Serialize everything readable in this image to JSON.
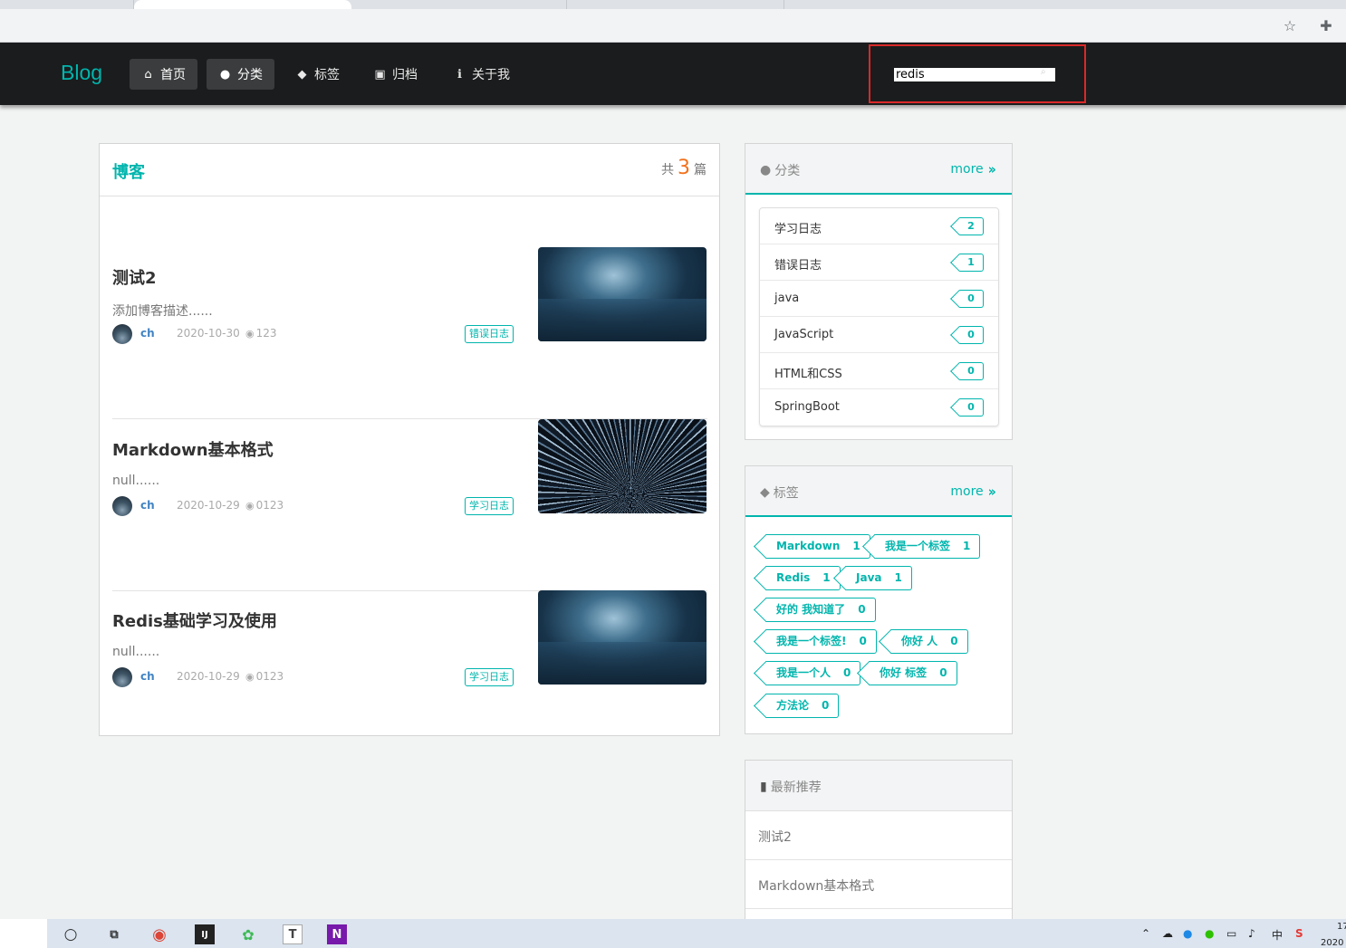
{
  "nav": {
    "logo": "Blog",
    "items": [
      {
        "label": "首页",
        "icon": "home-icon",
        "glyph": "⌂"
      },
      {
        "label": "分类",
        "icon": "lightbulb-icon",
        "glyph": "●"
      },
      {
        "label": "标签",
        "icon": "tags-icon",
        "glyph": "◆"
      },
      {
        "label": "归档",
        "icon": "archive-icon",
        "glyph": "▣"
      },
      {
        "label": "关于我",
        "icon": "info-icon",
        "glyph": "ℹ"
      }
    ],
    "search": {
      "value": "redis",
      "icon": "search-icon"
    }
  },
  "main": {
    "title": "博客",
    "count_prefix": "共",
    "count": "3",
    "count_suffix": "篇",
    "posts": [
      {
        "title": "测试2",
        "desc": "添加博客描述......",
        "author": "ch",
        "date": "2020-10-30",
        "views": "123",
        "tag": "错误日志",
        "image": "wave"
      },
      {
        "title": "Markdown基本格式",
        "desc": "null......",
        "author": "ch",
        "date": "2020-10-29",
        "views": "0123",
        "tag": "学习日志",
        "image": "stars"
      },
      {
        "title": "Redis基础学习及使用",
        "desc": "null......",
        "author": "ch",
        "date": "2020-10-29",
        "views": "0123",
        "tag": "学习日志",
        "image": "wave"
      }
    ]
  },
  "categories": {
    "title": "分类",
    "more": "more",
    "items": [
      {
        "name": "学习日志",
        "count": "2"
      },
      {
        "name": "错误日志",
        "count": "1"
      },
      {
        "name": "java",
        "count": "0"
      },
      {
        "name": "JavaScript",
        "count": "0"
      },
      {
        "name": "HTML和CSS",
        "count": "0"
      },
      {
        "name": "SpringBoot",
        "count": "0"
      }
    ]
  },
  "tags": {
    "title": "标签",
    "more": "more",
    "items": [
      {
        "name": "Markdown",
        "count": "1"
      },
      {
        "name": "我是一个标签",
        "count": "1"
      },
      {
        "name": "Redis",
        "count": "1"
      },
      {
        "name": "Java",
        "count": "1"
      },
      {
        "name": "好的 我知道了",
        "count": "0"
      },
      {
        "name": "我是一个标签!",
        "count": "0"
      },
      {
        "name": "你好 人",
        "count": "0"
      },
      {
        "name": "我是一个人",
        "count": "0"
      },
      {
        "name": "你好 标签",
        "count": "0"
      },
      {
        "name": "方法论",
        "count": "0"
      }
    ]
  },
  "recommend": {
    "title": "最新推荐",
    "items": [
      "测试2",
      "Markdown基本格式"
    ]
  },
  "colors": {
    "accent": "#00b5ad",
    "nav_bg": "#1b1c1d",
    "count": "#f2711c",
    "highlight": "#db2828"
  },
  "taskbar": {
    "clock_partial": "17",
    "year_partial": "2020",
    "ime": "中"
  }
}
